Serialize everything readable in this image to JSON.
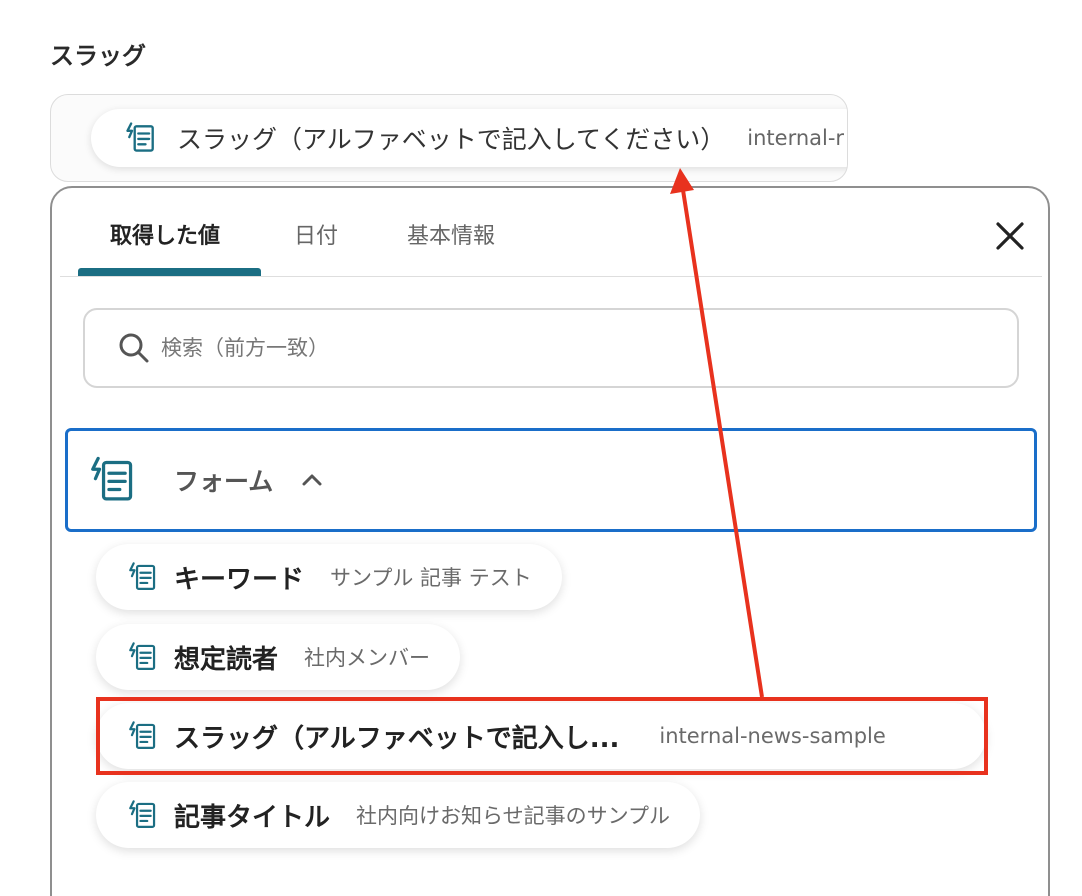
{
  "field": {
    "label": "スラッグ",
    "chip_label": "スラッグ（アルファベットで記入してください）",
    "chip_value": "internal-r"
  },
  "tabs": [
    {
      "label": "取得した値",
      "active": true
    },
    {
      "label": "日付",
      "active": false
    },
    {
      "label": "基本情報",
      "active": false
    }
  ],
  "search": {
    "placeholder": "検索（前方一致）",
    "value": ""
  },
  "group": {
    "label": "フォーム",
    "expanded": true
  },
  "items": [
    {
      "label": "キーワード",
      "value": "サンプル 記事 テスト"
    },
    {
      "label": "想定読者",
      "value": "社内メンバー"
    },
    {
      "label": "スラッグ（アルファベットで記入し...",
      "value": "internal-news-sample"
    },
    {
      "label": "記事タイトル",
      "value": "社内向けお知らせ記事のサンプル"
    }
  ],
  "colors": {
    "accent": "#1b6e83",
    "selection_border": "#1a6ec9",
    "annotation": "#e8321e"
  },
  "icons": {
    "form": "form-icon",
    "search": "search-icon",
    "close": "close-icon",
    "chevron": "chevron-up-icon"
  }
}
